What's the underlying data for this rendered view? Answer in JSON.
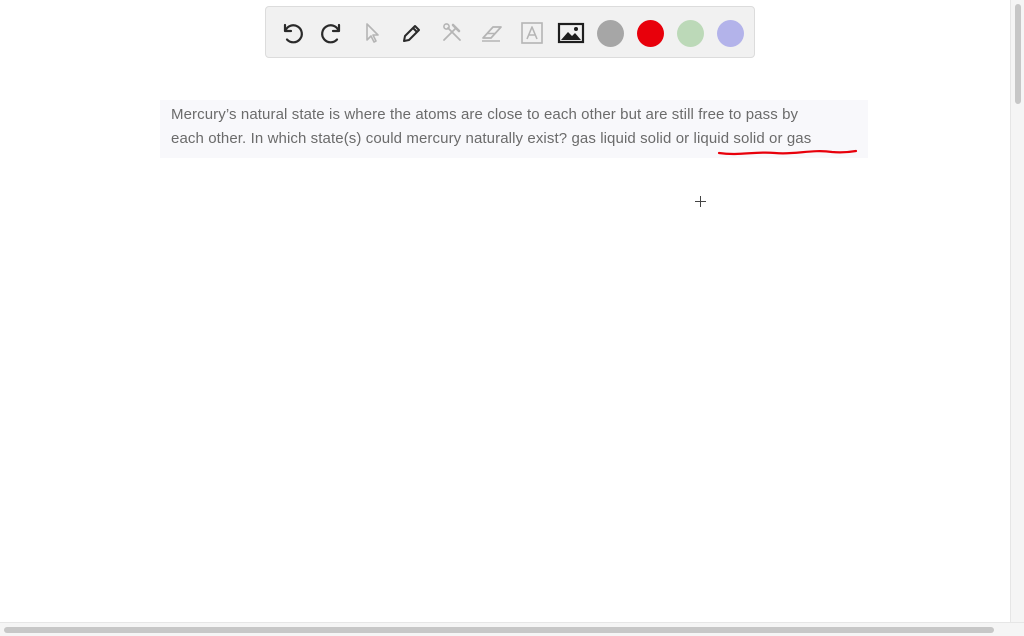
{
  "question": {
    "line1": "Mercury’s natural state is where the atoms are close to each other but are still free to pass by",
    "line2_prefix": "each other. In which state(s) could mercury naturally exist? gas liquid solid or ",
    "line2_answer": "liquid solid or gas"
  },
  "toolbar": {
    "tools": [
      "undo-icon",
      "redo-icon",
      "pointer-icon",
      "pen-icon",
      "tools-icon",
      "eraser-icon",
      "text-icon",
      "image-icon"
    ],
    "colors": {
      "gray": "#a6a6a6",
      "red": "#e8000b",
      "green": "#bcd9b8",
      "lavender": "#b3b3ea"
    }
  },
  "annotation": {
    "underline_color": "#e8000b"
  }
}
